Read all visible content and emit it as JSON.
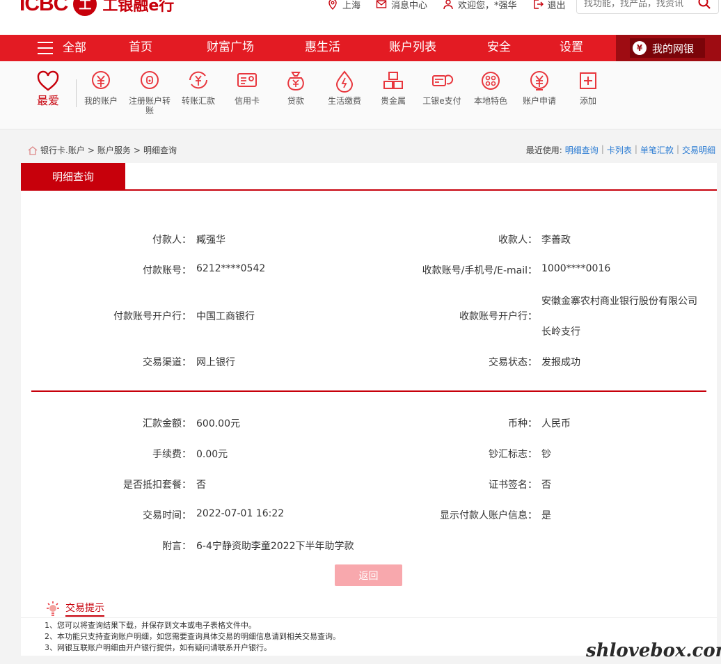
{
  "header": {
    "logo_icbc": "ICBC",
    "logo_mark": "工",
    "logo_text": "工银融e行",
    "location": "上海",
    "messages": "消息中心",
    "welcome": "欢迎您，*强华",
    "logout": "退出",
    "search_placeholder": "找功能，找产品，找资讯"
  },
  "nav": {
    "all": "全部",
    "items": [
      "首页",
      "财富广场",
      "惠生活",
      "账户列表",
      "安全",
      "设置"
    ],
    "mybank": "我的网银"
  },
  "quick": {
    "favorite": "最爱",
    "items": [
      {
        "label": "我的账户",
        "icon": "yuan-coin-icon"
      },
      {
        "label": "注册账户转账",
        "icon": "register-transfer-icon"
      },
      {
        "label": "转账汇款",
        "icon": "transfer-remit-icon"
      },
      {
        "label": "信用卡",
        "icon": "credit-card-icon"
      },
      {
        "label": "贷款",
        "icon": "loan-bag-icon"
      },
      {
        "label": "生活缴费",
        "icon": "utility-drop-icon"
      },
      {
        "label": "贵金属",
        "icon": "gold-bars-icon"
      },
      {
        "label": "工银e支付",
        "icon": "e-pay-icon"
      },
      {
        "label": "本地特色",
        "icon": "local-feature-icon"
      },
      {
        "label": "账户申请",
        "icon": "account-apply-icon"
      },
      {
        "label": "添加",
        "icon": "add-icon"
      }
    ]
  },
  "breadcrumb": {
    "items": [
      "银行卡.账户",
      "账户服务",
      "明细查询"
    ],
    "sep": ">",
    "recent_label": "最近使用:",
    "recent": [
      "明细查询",
      "卡列表",
      "单笔汇款",
      "交易明细"
    ],
    "recent_sep": "|"
  },
  "tab": {
    "active": "明细查询"
  },
  "detail": {
    "payer_label": "付款人：",
    "payer": "臧强华",
    "payee_label": "收款人：",
    "payee": "李善政",
    "payer_account_label": "付款账号：",
    "payer_account": "6212****0542",
    "payee_account_label": "收款账号/手机号/E-mail：",
    "payee_account": "1000****0016",
    "payer_bank_label": "付款账号开户行：",
    "payer_bank": "中国工商银行",
    "payee_bank_label": "收款账号开户行：",
    "payee_bank_line1": "安徽金寨农村商业银行股份有限公司",
    "payee_bank_line2": "长岭支行",
    "channel_label": "交易渠道：",
    "channel": "网上银行",
    "status_label": "交易状态：",
    "status": "发报成功",
    "amount_label": "汇款金额：",
    "amount": "600.00元",
    "currency_label": "币种：",
    "currency": "人民币",
    "fee_label": "手续费：",
    "fee": "0.00元",
    "cash_label": "钞汇标志：",
    "cash": "钞",
    "package_label": "是否抵扣套餐：",
    "package": "否",
    "cert_label": "证书签名：",
    "cert": "否",
    "time_label": "交易时间：",
    "time": "2022-07-01 16:22",
    "show_payer_label": "显示付款人账户信息：",
    "show_payer": "是",
    "note_label": "附言：",
    "note": "6-4宁静资助李童2022下半年助学款"
  },
  "back_button": "返回",
  "tips": {
    "title": "交易提示",
    "lines": [
      "1、您可以将查询结果下载，并保存到文本或电子表格文件中。",
      "2、本功能只支持查询账户明细，如您需要查询具体交易的明细信息请到相关交易查询。",
      "3、网银互联账户明细由开户银行提供，如有疑问请联系开户银行。"
    ]
  },
  "watermark": "shlovebox.com",
  "colors": {
    "brand": "#c7000b",
    "nav": "#e31b23",
    "link": "#2a7bd3",
    "button": "#f8a8ad"
  }
}
